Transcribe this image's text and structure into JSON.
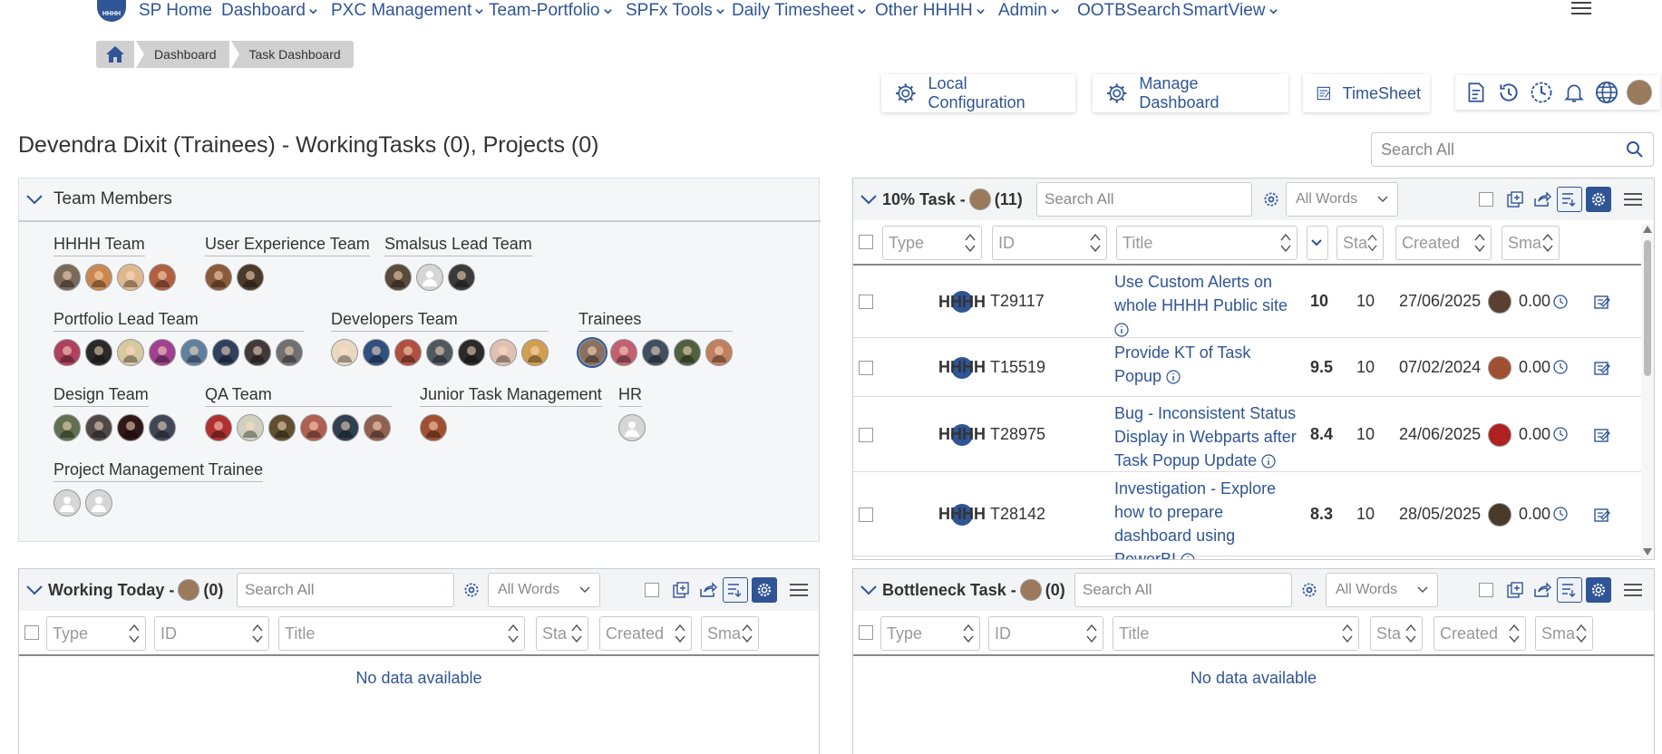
{
  "nav": {
    "logo": "HHHH",
    "items": [
      {
        "label": "SP Home",
        "chev": false
      },
      {
        "label": "Dashboard",
        "chev": true
      },
      {
        "label": "PXC Management",
        "chev": true
      },
      {
        "label": "Team-Portfolio",
        "chev": true
      },
      {
        "label": "SPFx Tools",
        "chev": true
      },
      {
        "label": "Daily Timesheet",
        "chev": true
      },
      {
        "label": "Other HHHH",
        "chev": true
      },
      {
        "label": "Admin",
        "chev": true
      },
      {
        "label": "OOTBSearch",
        "chev": false
      },
      {
        "label": "SmartView",
        "chev": true
      }
    ]
  },
  "breadcrumb": [
    "Dashboard",
    "Task Dashboard"
  ],
  "actions": {
    "local_config": "Local Configuration",
    "manage_dashboard": "Manage Dashboard",
    "timesheet": "TimeSheet"
  },
  "page_title": "Devendra Dixit (Trainees) - WorkingTasks (0), Projects (0)",
  "search_placeholder": "Search All",
  "team": {
    "title": "Team Members",
    "groups": [
      {
        "name": "HHHH Team",
        "avatars": [
          "#7a6a5a",
          "#c98850",
          "#e0b890",
          "#b06040"
        ]
      },
      {
        "name": "User Experience Team",
        "avatars": [
          "#8a5a3a",
          "#4a3a2a"
        ]
      },
      {
        "name": "Smalsus Lead Team",
        "avatars": [
          "#5a4a3a",
          "ph",
          "#3a3a3a"
        ]
      },
      {
        "name": "Portfolio Lead Team",
        "avatars": [
          "#b04060",
          "#2a2a2a",
          "#d8c8a0",
          "#a04090",
          "#6080a0",
          "#304060",
          "#403a3a",
          "#707070"
        ]
      },
      {
        "name": "Developers Team",
        "avatars": [
          "#e8d8c0",
          "#305080",
          "#b05040",
          "#505860",
          "#2a2a2a",
          "#e0c0b0",
          "#d0a050"
        ]
      },
      {
        "name": "Trainees",
        "avatars": [
          "#8a7060",
          "#c06070",
          "#405060",
          "#506040",
          "#c08060"
        ]
      },
      {
        "name": "Design Team",
        "avatars": [
          "#607050",
          "#504848",
          "#301818",
          "#404858"
        ]
      },
      {
        "name": "QA Team",
        "avatars": [
          "#b03030",
          "#d0d0c0",
          "#605030",
          "#b06050",
          "#304050",
          "#906050"
        ]
      },
      {
        "name": "Junior Task Management",
        "avatars": [
          "#a05030"
        ]
      },
      {
        "name": "HR",
        "avatars": [
          "ph"
        ]
      },
      {
        "name": "Project Management Trainee",
        "avatars": [
          "ph",
          "ph"
        ]
      }
    ]
  },
  "grid_common": {
    "words": "All Words",
    "columns": {
      "type": "Type",
      "id": "ID",
      "title": "Title",
      "status": "Sta",
      "created": "Created",
      "smart": "Sma"
    },
    "no_data": "No data available"
  },
  "ten_percent": {
    "title": "10% Task -",
    "count": "(11)",
    "rows": [
      {
        "id": "T29117",
        "title": "Use Custom Alerts on whole HHHH Public site",
        "priority": "10",
        "status": "10",
        "created": "27/06/2025",
        "smart": "0.00",
        "av": "#5a4030"
      },
      {
        "id": "T15519",
        "title": "Provide KT of Task Popup",
        "priority": "9.5",
        "status": "10",
        "created": "07/02/2024",
        "smart": "0.00",
        "av": "#a05030"
      },
      {
        "id": "T28975",
        "title": "Bug - Inconsistent Status Display in Webparts after Task Popup Update",
        "priority": "8.4",
        "status": "10",
        "created": "24/06/2025",
        "smart": "0.00",
        "av": "#b02020"
      },
      {
        "id": "T28142",
        "title": "Investigation - Explore how to prepare dashboard using PowerBI",
        "priority": "8.3",
        "status": "10",
        "created": "28/05/2025",
        "smart": "0.00",
        "av": "#4a3a2a"
      }
    ]
  },
  "working_today": {
    "title": "Working Today -",
    "count": "(0)"
  },
  "bottleneck": {
    "title": "Bottleneck Task -",
    "count": "(0)"
  }
}
